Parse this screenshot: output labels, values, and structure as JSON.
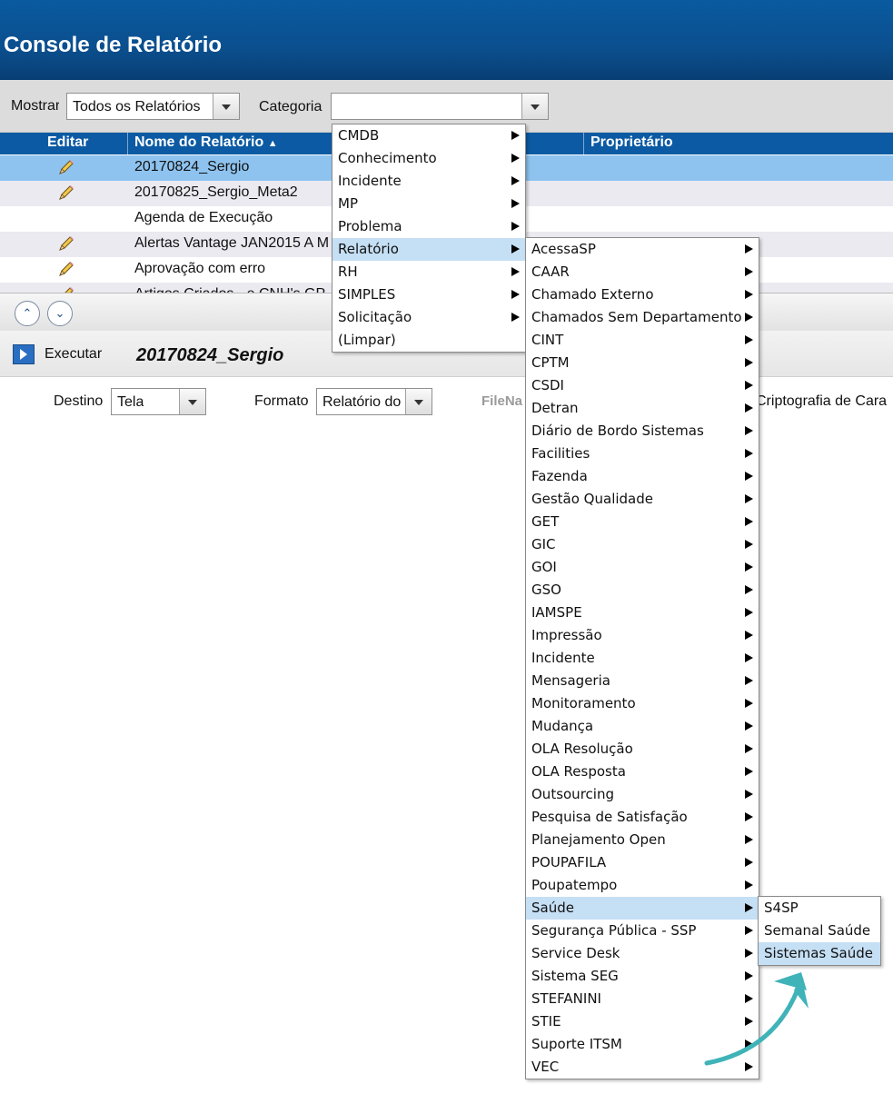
{
  "header": {
    "title": "Console de Relatório"
  },
  "filters": {
    "show_label": "Mostrar",
    "show_value": "Todos os Relatórios",
    "category_label": "Categoria",
    "category_value": ""
  },
  "table": {
    "columns": {
      "edit": "Editar",
      "name": "Nome do Relatório",
      "owner": "Proprietário"
    },
    "rows": [
      {
        "name": "20170824_Sergio",
        "editable": true
      },
      {
        "name": "20170825_Sergio_Meta2",
        "editable": true
      },
      {
        "name": "Agenda de Execução",
        "editable": false
      },
      {
        "name": "Alertas Vantage JAN2015 A M",
        "editable": true
      },
      {
        "name": "Aprovação com erro",
        "editable": true
      },
      {
        "name": "Artigos Criados - e CNH's GP",
        "editable": true
      }
    ]
  },
  "run": {
    "execute_label": "Executar",
    "selected_report": "20170824_Sergio",
    "destination_label": "Destino",
    "destination_value": "Tela",
    "format_label": "Formato",
    "format_value": "Relatório do",
    "filename_label": "FileNa",
    "crypto_label": "Criptografia de Cara"
  },
  "menu_level1": [
    "CMDB",
    "Conhecimento",
    "Incidente",
    "MP",
    "Problema",
    "Relatório",
    "RH",
    "SIMPLES",
    "Solicitação",
    "(Limpar)"
  ],
  "menu_level1_selected": "Relatório",
  "menu_level2": [
    "AcessaSP",
    "CAAR",
    "Chamado Externo",
    "Chamados Sem Departamento",
    "CINT",
    "CPTM",
    "CSDI",
    "Detran",
    "Diário de Bordo Sistemas",
    "Facilities",
    "Fazenda",
    "Gestão Qualidade",
    "GET",
    "GIC",
    "GOI",
    "GSO",
    "IAMSPE",
    "Impressão",
    "Incidente",
    "Mensageria",
    "Monitoramento",
    "Mudança",
    "OLA Resolução",
    "OLA Resposta",
    "Outsourcing",
    "Pesquisa de Satisfação",
    "Planejamento Open",
    "POUPAFILA",
    "Poupatempo",
    "Saúde",
    "Segurança Pública - SSP",
    "Service Desk",
    "Sistema SEG",
    "STEFANINI",
    "STIE",
    "Suporte ITSM",
    "VEC"
  ],
  "menu_level2_selected": "Saúde",
  "menu_level3": [
    "S4SP",
    "Semanal Saúde",
    "Sistemas Saúde"
  ],
  "menu_level3_selected": "Sistemas Saúde",
  "colors": {
    "header_bg": "#0b4f8e",
    "selected_row": "#8ec3ef",
    "menu_highlight": "#c5dff4",
    "annotation_arrow": "#3fb3b8"
  }
}
